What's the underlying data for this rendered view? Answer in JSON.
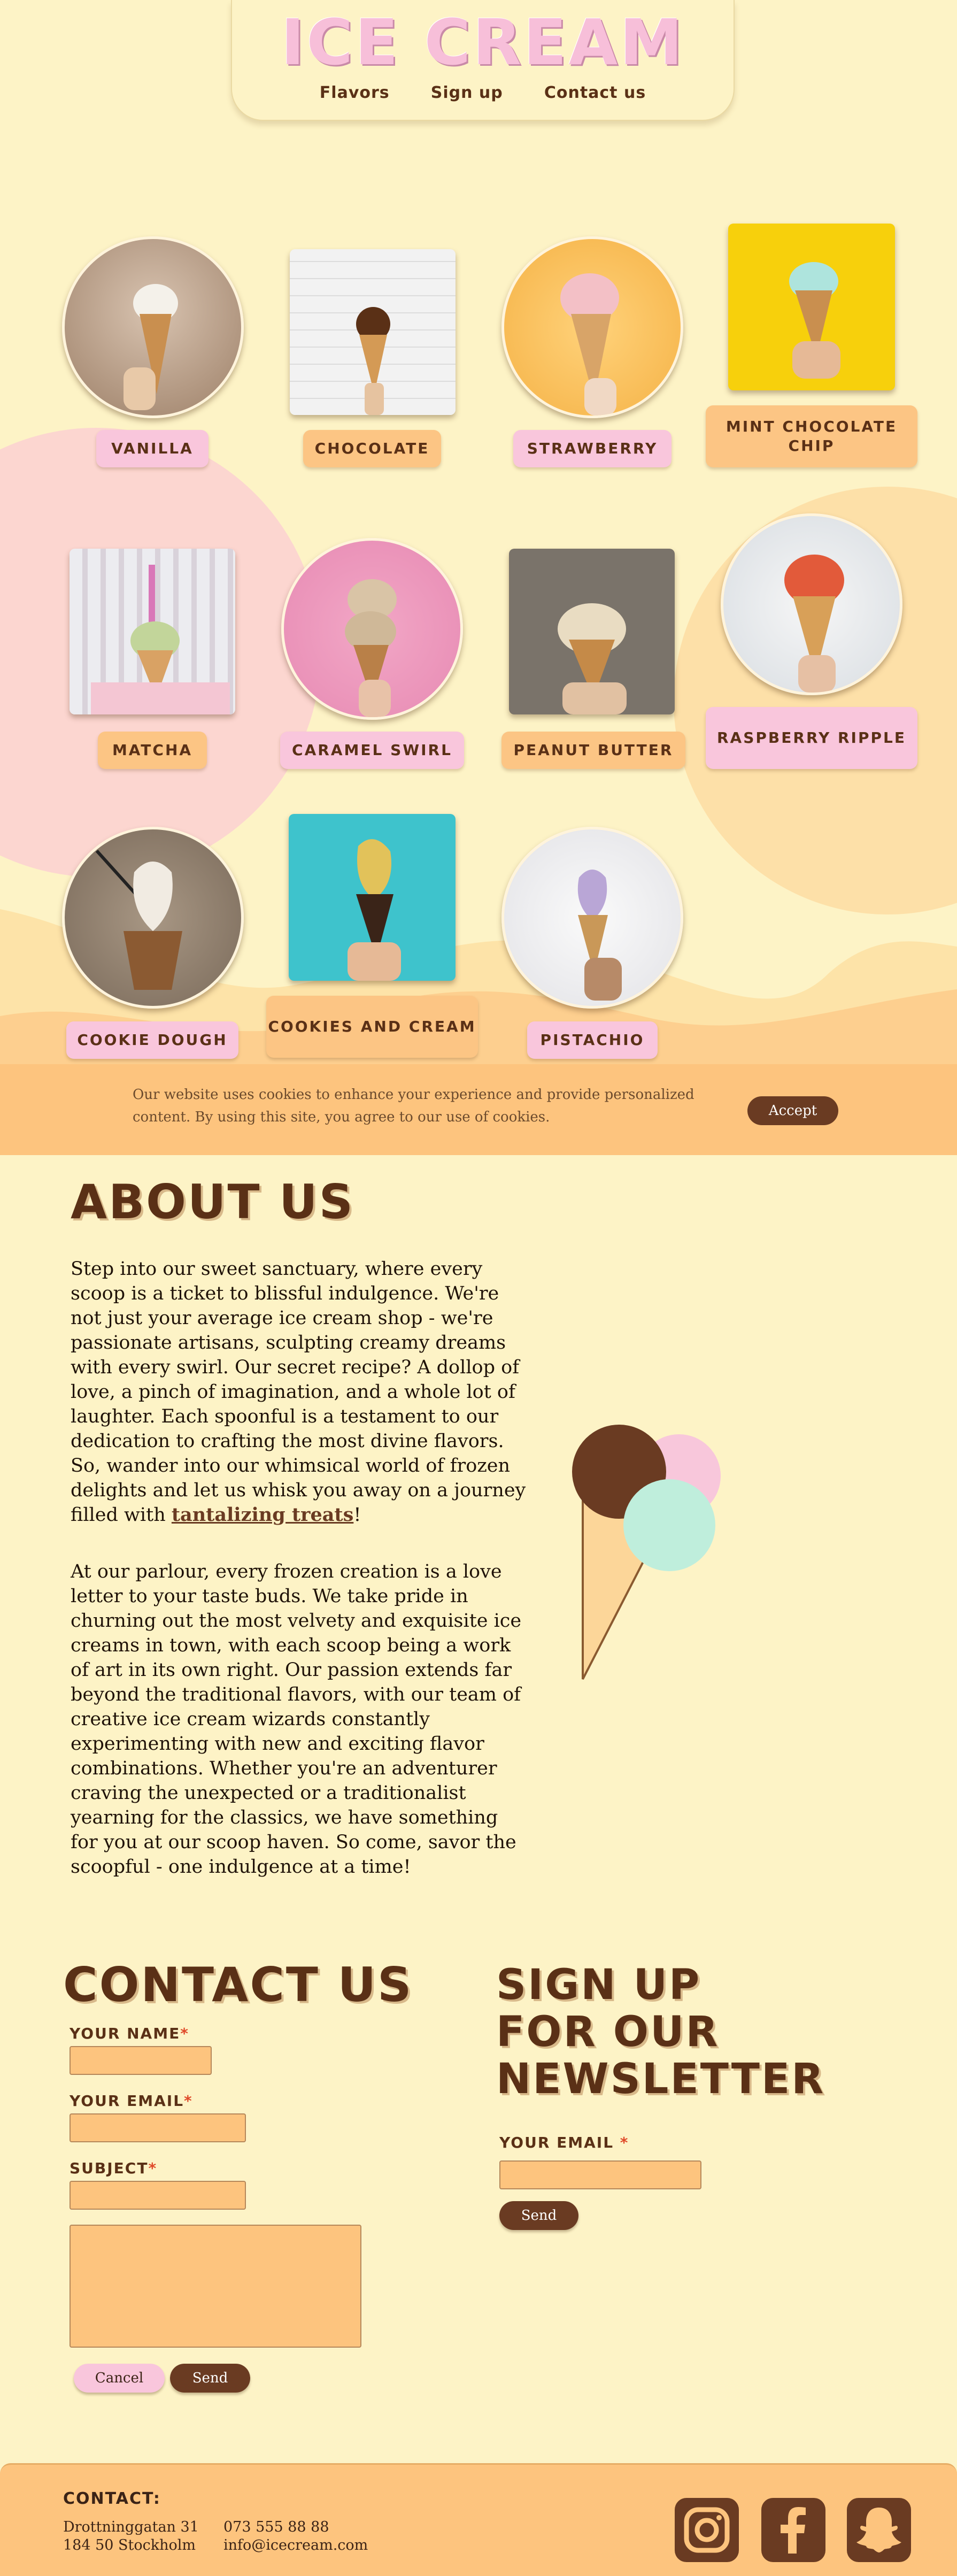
{
  "header": {
    "logo": "Ice cream",
    "nav": [
      "Flavors",
      "Sign up",
      "Contact us"
    ]
  },
  "flavors": [
    {
      "label": "Vanilla"
    },
    {
      "label": "Chocolate"
    },
    {
      "label": "Strawberry"
    },
    {
      "label": "Mint Chocolate Chip"
    },
    {
      "label": "Matcha"
    },
    {
      "label": "Caramel Swirl"
    },
    {
      "label": "Peanut Butter"
    },
    {
      "label": "Raspberry Ripple"
    },
    {
      "label": "Cookie Dough"
    },
    {
      "label": "Cookies and Cream"
    },
    {
      "label": "Pistachio"
    }
  ],
  "cookie": {
    "text": "Our website uses cookies to enhance your experience and provide personalized content. By using this site, you agree to our use of cookies.",
    "accept_label": "Accept"
  },
  "about": {
    "title": "About us",
    "p1_before": "Step into our sweet sanctuary, where every scoop is a ticket to blissful indulgence. We're not just your average ice cream shop - we're passionate artisans, sculpting creamy dreams with every swirl. Our secret recipe? A dollop of love, a pinch of imagination, and a whole lot of laughter. Each spoonful is a testament to our dedication to crafting the most divine flavors. So, wander into our whimsical world of frozen delights and let us whisk you away on a journey filled with ",
    "p1_link": "tantalizing treats",
    "p1_after": "!",
    "p2": "At our parlour, every frozen creation is a love letter to your taste buds. We take pride in churning out the most velvety and exquisite ice creams in town, with each scoop being a work of art in its own right. Our passion extends far beyond the traditional flavors, with our team of creative ice cream wizards constantly experimenting with new and exciting flavor combinations. Whether you're an adventurer craving the unexpected or a traditionalist yearning for the classics, we have something for you at our scoop haven. So come, savor the scoopful - one indulgence at a time!"
  },
  "contact": {
    "title": "Contact us",
    "name_label": "Your name",
    "email_label": "Your email",
    "subject_label": "Subject",
    "required_mark": "*",
    "cancel_label": "Cancel",
    "send_label": "Send"
  },
  "newsletter": {
    "title_line1": "Sign up",
    "title_line2": "for our",
    "title_line3": "newsletter",
    "email_label": "Your email",
    "required_mark": "*",
    "send_label": "Send"
  },
  "footer": {
    "title": "Contact:",
    "address_line1": "Drottninggatan 31",
    "address_line2": "184 50 Stockholm",
    "phone": "073 555 88 88",
    "email": "info@icecream.com",
    "social_icons": [
      "instagram-icon",
      "facebook-icon",
      "snapchat-icon"
    ]
  },
  "colors": {
    "background": "#fdf3c6",
    "pink": "#f9c6dc",
    "orange": "#fcc584",
    "brown": "#6a3b22"
  }
}
